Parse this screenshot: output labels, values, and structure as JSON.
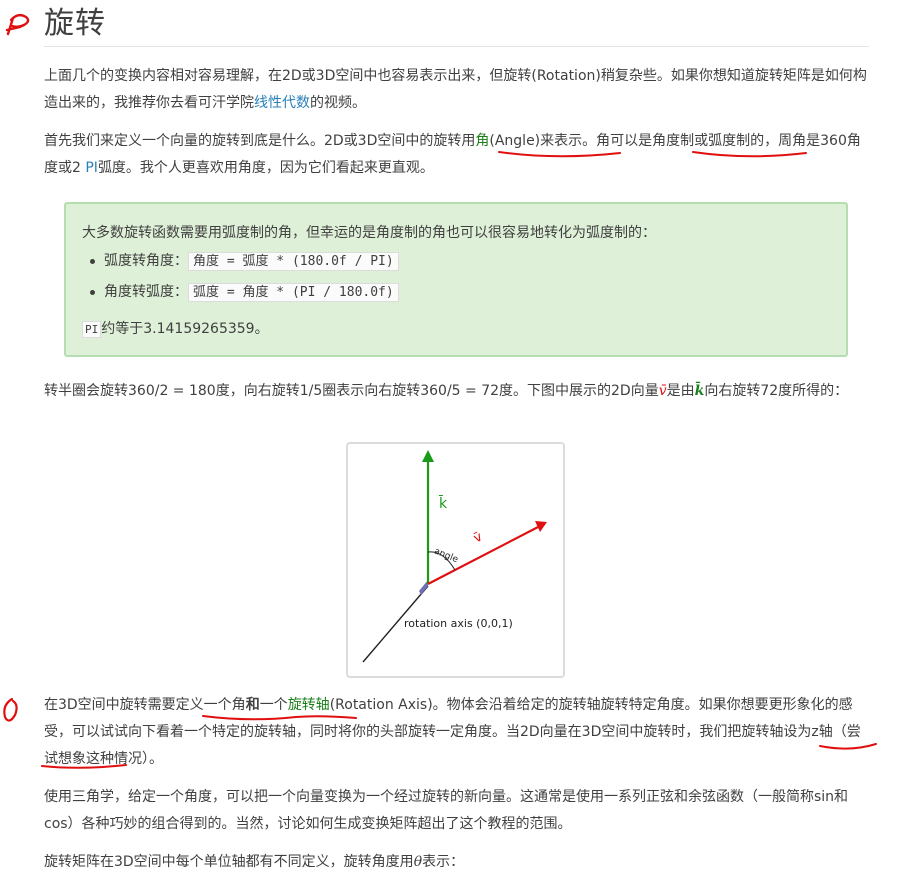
{
  "header": {
    "title": "旋转"
  },
  "p1": {
    "before_link": "上面几个的变换内容相对容易理解，在2D或3D空间中也容易表示出来，但旋转(Rotation)稍复杂些。如果你想知道旋转矩阵是如何构造出来的，我推荐你去看可汗学院",
    "link": "线性代数",
    "after_link": "的视频。"
  },
  "p2": {
    "part1": "首先我们来定义一个向量的旋转到底是什么。2D或3D空间中的旋转用",
    "angle_word": "角",
    "part2": "(Angle)来表示。角可以是角度制或弧度制的，周角是360角度或2 ",
    "pi_link": "PI",
    "part3": "弧度。我个人更喜欢用角度，因为它们看起来更直观。"
  },
  "note": {
    "intro": "大多数旋转函数需要用弧度制的角，但幸运的是角度制的角也可以很容易地转化为弧度制的：",
    "items": [
      {
        "label": "弧度转角度：",
        "code": "角度 = 弧度 * (180.0f / PI)"
      },
      {
        "label": "角度转弧度：",
        "code": "弧度 = 角度 * (PI / 180.0f)"
      }
    ],
    "pi_code": "PI",
    "pi_text": "约等于3.14159265359。"
  },
  "p3": {
    "part1": "转半圈会旋转360/2 = 180度，向右旋转1/5圈表示向右旋转360/5 = 72度。下图中展示的2D向量",
    "v_symbol": "v̄",
    "part2": "是由",
    "k_symbol": "k̄",
    "part3": "向右旋转72度所得的："
  },
  "figure": {
    "k_label": "k̄",
    "v_label": "v̄",
    "angle_label": "angle",
    "axis_label": "rotation axis (0,0,1)",
    "colors": {
      "k": "#1a9a1a",
      "v": "#e01010",
      "axis": "#222222",
      "square": "#6f6fb8"
    }
  },
  "p4": {
    "part1": "在3D空间中旋转需要定义一个角",
    "and_word": "和",
    "part2": "一个",
    "axis_word": "旋转轴",
    "part3": "(Rotation Axis)。物体会沿着给定的旋转轴旋转特定角度。如果你想要更形象化的感受，可以试试向下看着一个特定的旋转轴，同时将你的头部旋转一定角度。当2D向量在3D空间中旋转时，我们把旋转轴设为z轴（尝试想象这种情况）。"
  },
  "p5": {
    "text": "使用三角学，给定一个角度，可以把一个向量变换为一个经过旋转的新向量。这通常是使用一系列正弦和余弦函数（一般简称sin和cos）各种巧妙的组合得到的。当然，讨论如何生成变换矩阵超出了这个教程的范围。"
  },
  "p6": {
    "text": "旋转矩阵在3D空间中每个单位轴都有不同定义，旋转角度用",
    "theta": "θ",
    "after": "表示："
  },
  "annotation_color": "#e01010"
}
